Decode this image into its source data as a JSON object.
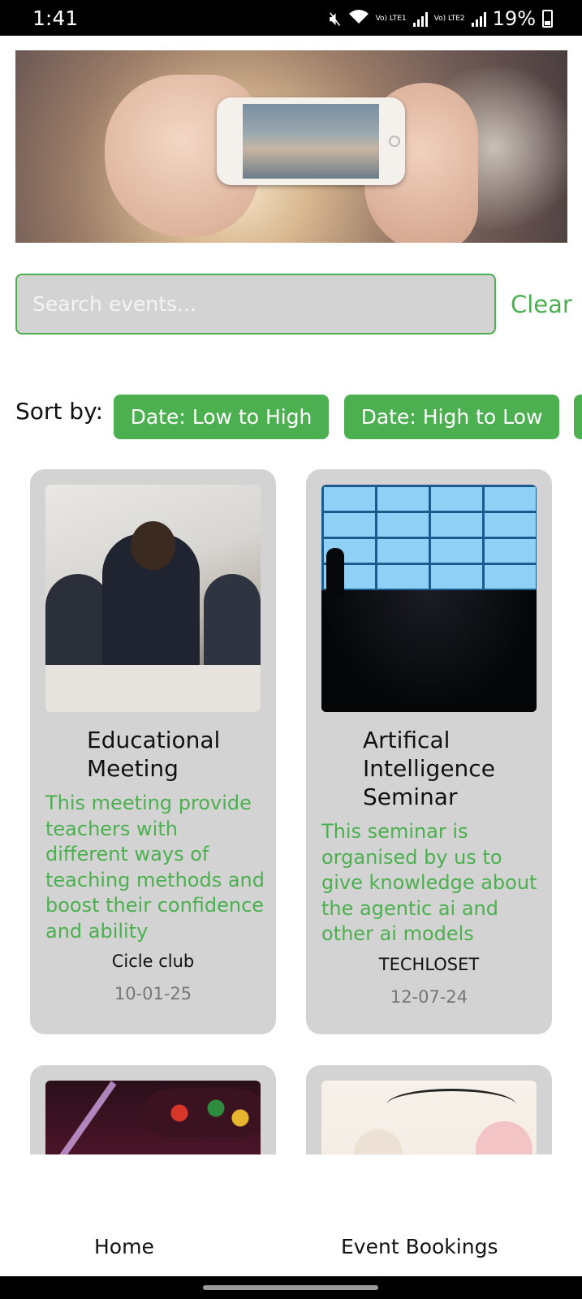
{
  "status_bar": {
    "time": "1:41",
    "battery": "19%",
    "sim1": "Vo) LTE1",
    "sim2": "Vo) LTE2"
  },
  "hero": {
    "image": "photo-hands-phone-party"
  },
  "search": {
    "placeholder": "Search events...",
    "value": "",
    "clear_label": "Clear"
  },
  "sort": {
    "label": "Sort by:",
    "options": [
      "Date: Low to High",
      "Date: High to Low",
      ""
    ]
  },
  "events": [
    {
      "title": "Educational Meeting",
      "description": "This meeting provide teachers with different ways of teaching methods and boost their confidence and ability",
      "organizer": "Cicle club",
      "date": "10-01-25"
    },
    {
      "title": "Artifical Intelligence Seminar",
      "description": "This seminar is organised by us to give knowledge about the agentic ai and other ai models",
      "organizer": "TECHLOSET",
      "date": "12-07-24"
    },
    {
      "title": "",
      "description": "",
      "organizer": "",
      "date": ""
    },
    {
      "title": "",
      "description": "",
      "organizer": "",
      "date": ""
    }
  ],
  "bottom_nav": {
    "home": "Home",
    "bookings": "Event Bookings"
  },
  "colors": {
    "accent": "#4caf50",
    "card_bg": "#d3d3d3",
    "status_bar": "#000000"
  }
}
